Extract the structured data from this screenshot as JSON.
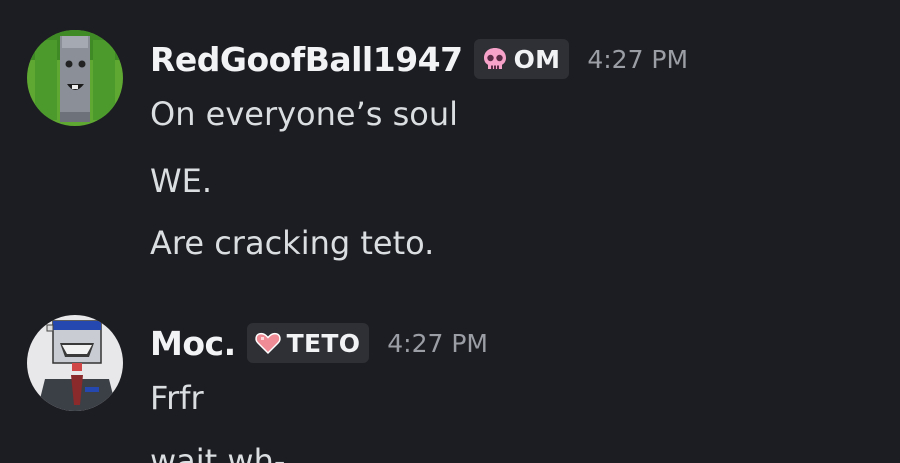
{
  "messages": [
    {
      "username": "RedGoofBall1947",
      "tag": {
        "icon": "skull-icon",
        "label": "OM",
        "icon_color": "#f7a3c9"
      },
      "timestamp": "4:27 PM",
      "lines": [
        "On everyone’s soul",
        "WE.",
        "Are cracking teto."
      ]
    },
    {
      "username": "Moc.",
      "tag": {
        "icon": "heart-icon",
        "label": "TETO",
        "icon_color": "#f08c96"
      },
      "timestamp": "4:27 PM",
      "lines": [
        "Frfr",
        "wait wh-"
      ]
    }
  ],
  "colors": {
    "background": "#1c1d22",
    "username": "#f2f3f5",
    "text": "#dbdee1",
    "timestamp": "#9b9ea5",
    "tag_background": "#2e3036"
  }
}
